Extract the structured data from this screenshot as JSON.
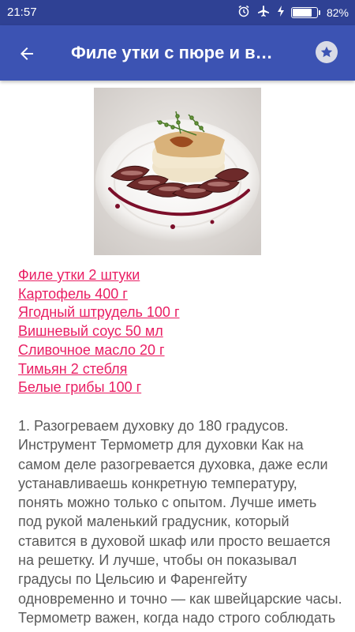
{
  "status_bar": {
    "time": "21:57",
    "battery_percent": "82%",
    "battery_level": 0.82,
    "icons": [
      "alarm-icon",
      "airplane-icon",
      "charging-icon",
      "battery-icon"
    ]
  },
  "app_bar": {
    "title": "Филе утки с пюре и в…",
    "back_icon": "arrow-left-icon",
    "favorite_icon": "star-icon",
    "background": "#3c53b3",
    "status_background": "#2f4194"
  },
  "ingredients": [
    "Филе утки 2 штуки",
    "Картофель 400 г",
    "Ягодный штрудель 100 г",
    "Вишневый соус 50 мл",
    "Сливочное масло 20 г",
    "Тимьян 2 стебля",
    "Белые грибы 100 г"
  ],
  "instructions": "1. Разогреваем духовку до 180 градусов. Инструмент Термометр для духовки Как на самом деле разогревается духовка, даже если устанавливаешь конкретную температуру, понять можно только с опытом. Лучше иметь под рукой маленький градусник, который ставится в духовой шкаф или просто вешается на решетку. И лучше, чтобы он показывал градусы по Цельсию и Фаренгейту одновременно и точно — как швейцарские часы. Термометр важен, когда надо строго соблюдать",
  "colors": {
    "link": "#e91e63",
    "body_text": "#5a5a5a"
  }
}
